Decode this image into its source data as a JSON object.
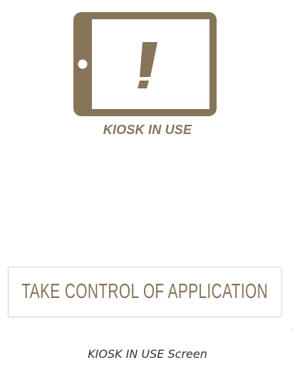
{
  "kiosk": {
    "icon": "tablet-exclamation-icon",
    "label": "KIOSK IN USE"
  },
  "take_control": {
    "label": "TAKE CONTROL OF APPLICATION"
  },
  "caption": "KIOSK IN USE Screen",
  "colors": {
    "brand": "#867559",
    "button_border": "#d6d6d6",
    "caption_text": "#333333",
    "background": "#ffffff"
  }
}
